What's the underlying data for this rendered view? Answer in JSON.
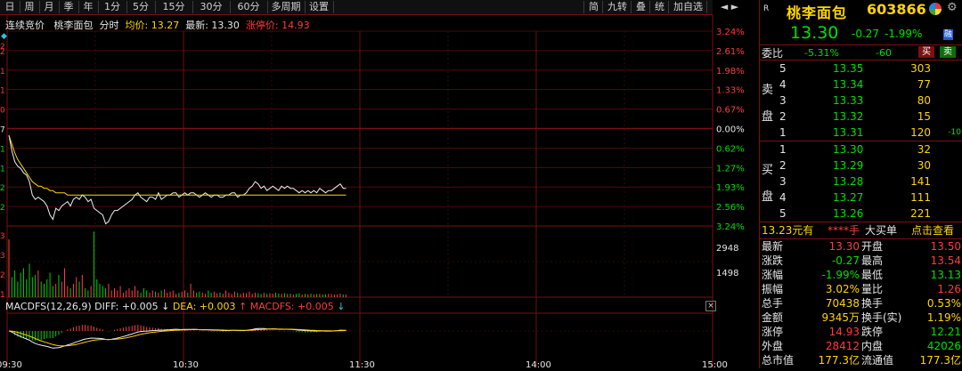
{
  "toolbar": {
    "periods": [
      "日",
      "周",
      "月",
      "季",
      "年",
      "1分",
      "5分",
      "15分",
      "30分",
      "60分",
      "多周期",
      "设置"
    ],
    "right_tools": [
      "简",
      "九转",
      "叠",
      "统",
      "加自选"
    ]
  },
  "chart_header": {
    "mode": "连续竞价",
    "stock_name": "桃李面包",
    "view": "分时",
    "avg_label": "均价: 13.27",
    "last_label": "最新: 13.30",
    "limit_up_label": "涨停价: 14.93"
  },
  "axis": {
    "right_pct": [
      "3.24%",
      "2.61%",
      "1.98%",
      "1.33%",
      "0.67%",
      "0.00%",
      "0.62%",
      "1.27%",
      "1.93%",
      "2.56%",
      "3.24%"
    ],
    "left_labels": [
      "2",
      "2",
      "1",
      "1",
      "0",
      "7",
      "1",
      "1",
      "2",
      "2"
    ],
    "vol_labels": [
      "2948",
      "1498"
    ],
    "vol_left": [
      "3",
      "3",
      "2",
      "1"
    ],
    "time_labels": [
      "09:30",
      "10:30",
      "11:30",
      "14:00",
      "15:00"
    ]
  },
  "macd": {
    "label": "MACDFS(12,26,9)",
    "diff": "DIFF: +0.005",
    "dea": "DEA: +0.003",
    "macdfs": "MACDFS: +0.005"
  },
  "panel": {
    "r_mark": "R",
    "name": "桃李面包",
    "code": "603866",
    "price": "13.30",
    "change": "-0.27",
    "change_pct": "-1.99%",
    "market_badge": "融",
    "weibi_label": "委比",
    "weibi_pct": "-5.31%",
    "weibi_val": "-60",
    "buy_btn": "买",
    "sell_btn": "卖",
    "sell_side_label": [
      "卖",
      "盘"
    ],
    "buy_side_label": [
      "买",
      "盘"
    ],
    "asks": [
      {
        "level": "5",
        "price": "13.35",
        "vol": "303",
        "delta": ""
      },
      {
        "level": "4",
        "price": "13.34",
        "vol": "77",
        "delta": ""
      },
      {
        "level": "3",
        "price": "13.33",
        "vol": "80",
        "delta": ""
      },
      {
        "level": "2",
        "price": "13.32",
        "vol": "15",
        "delta": ""
      },
      {
        "level": "1",
        "price": "13.31",
        "vol": "120",
        "delta": "-10"
      }
    ],
    "bids": [
      {
        "level": "1",
        "price": "13.30",
        "vol": "32"
      },
      {
        "level": "2",
        "price": "13.29",
        "vol": "30"
      },
      {
        "level": "3",
        "price": "13.28",
        "vol": "141"
      },
      {
        "level": "4",
        "price": "13.27",
        "vol": "111"
      },
      {
        "level": "5",
        "price": "13.26",
        "vol": "221"
      }
    ],
    "bar": {
      "price": "13.23元有",
      "stars": "****手",
      "big": "大买单",
      "link": "点击查看"
    },
    "stats": [
      {
        "l1": "最新",
        "v1": "13.30",
        "c1": "red",
        "l2": "开盘",
        "v2": "13.50",
        "c2": "red"
      },
      {
        "l1": "涨跌",
        "v1": "-0.27",
        "c1": "green",
        "l2": "最高",
        "v2": "13.54",
        "c2": "red"
      },
      {
        "l1": "涨幅",
        "v1": "-1.99%",
        "c1": "green",
        "l2": "最低",
        "v2": "13.13",
        "c2": "green"
      },
      {
        "l1": "振幅",
        "v1": "3.02%",
        "c1": "yellow",
        "l2": "量比",
        "v2": "1.26",
        "c2": "red"
      },
      {
        "l1": "总手",
        "v1": "70438",
        "c1": "yellow",
        "l2": "换手",
        "v2": "0.53%",
        "c2": "yellow"
      },
      {
        "l1": "金额",
        "v1": "9345万",
        "c1": "yellow",
        "l2": "换手(实)",
        "v2": "1.19%",
        "c2": "yellow"
      },
      {
        "l1": "涨停",
        "v1": "14.93",
        "c1": "red",
        "l2": "跌停",
        "v2": "12.21",
        "c2": "green"
      },
      {
        "l1": "外盘",
        "v1": "28412",
        "c1": "red",
        "l2": "内盘",
        "v2": "42026",
        "c2": "green"
      },
      {
        "l1": "总市值",
        "v1": "177.3亿",
        "c1": "yellow",
        "l2": "流通值",
        "v2": "177.3亿",
        "c2": "yellow"
      }
    ]
  },
  "chart_data": {
    "type": "line",
    "price_series": [
      13.54,
      13.47,
      13.42,
      13.4,
      13.39,
      13.37,
      13.36,
      13.33,
      13.27,
      13.25,
      13.26,
      13.25,
      13.24,
      13.22,
      13.18,
      13.16,
      13.21,
      13.2,
      13.22,
      13.23,
      13.24,
      13.22,
      13.25,
      13.26,
      13.25,
      13.27,
      13.26,
      13.24,
      13.25,
      13.21,
      13.2,
      13.19,
      13.18,
      13.14,
      13.15,
      13.18,
      13.2,
      13.2,
      13.21,
      13.22,
      13.23,
      13.24,
      13.25,
      13.27,
      13.28,
      13.26,
      13.25,
      13.24,
      13.26,
      13.26,
      13.25,
      13.28,
      13.25,
      13.26,
      13.27,
      13.27,
      13.28,
      13.28,
      13.26,
      13.27,
      13.28,
      13.27,
      13.28,
      13.28,
      13.27,
      13.26,
      13.27,
      13.28,
      13.27,
      13.26,
      13.27,
      13.27,
      13.26,
      13.26,
      13.27,
      13.27,
      13.28,
      13.28,
      13.26,
      13.27,
      13.27,
      13.28,
      13.3,
      13.31,
      13.33,
      13.32,
      13.3,
      13.31,
      13.29,
      13.3,
      13.31,
      13.3,
      13.29,
      13.31,
      13.3,
      13.31,
      13.3,
      13.3,
      13.29,
      13.28,
      13.29,
      13.28,
      13.29,
      13.28,
      13.29,
      13.28,
      13.3,
      13.29,
      13.28,
      13.29,
      13.29,
      13.3,
      13.31,
      13.32,
      13.3,
      13.3
    ],
    "avg_series": [
      13.54,
      13.5,
      13.46,
      13.43,
      13.41,
      13.39,
      13.37,
      13.35,
      13.33,
      13.32,
      13.31,
      13.31,
      13.3,
      13.3,
      13.29,
      13.29,
      13.28,
      13.28,
      13.28,
      13.28,
      13.27,
      13.27,
      13.27,
      13.27,
      13.27,
      13.27,
      13.27,
      13.27,
      13.27,
      13.27,
      13.27,
      13.27,
      13.27,
      13.27,
      13.27,
      13.27,
      13.27,
      13.27,
      13.27,
      13.27,
      13.27,
      13.27,
      13.27,
      13.27,
      13.27,
      13.27,
      13.27,
      13.27,
      13.27,
      13.27,
      13.27,
      13.27,
      13.27,
      13.27,
      13.27,
      13.27,
      13.27,
      13.27,
      13.27,
      13.27,
      13.27,
      13.27,
      13.27,
      13.27,
      13.27,
      13.27,
      13.27,
      13.27,
      13.27,
      13.27,
      13.27,
      13.27,
      13.27,
      13.27,
      13.27,
      13.27,
      13.27,
      13.27,
      13.27,
      13.27,
      13.27,
      13.27,
      13.27,
      13.27,
      13.27,
      13.27,
      13.27,
      13.27,
      13.27,
      13.27,
      13.27,
      13.27,
      13.27,
      13.27,
      13.27,
      13.27,
      13.27,
      13.27,
      13.27,
      13.27,
      13.27,
      13.27,
      13.27,
      13.27,
      13.27,
      13.27,
      13.27,
      13.27,
      13.27,
      13.27,
      13.27,
      13.27,
      13.27,
      13.27,
      13.27,
      13.27
    ],
    "prev_close": 13.57,
    "price_range": [
      13.13,
      14.01
    ],
    "volume_series": [
      2600,
      900,
      1200,
      700,
      1100,
      1300,
      800,
      1500,
      900,
      1000,
      1200,
      700,
      600,
      800,
      1100,
      500,
      600,
      1000,
      700,
      1300,
      500,
      400,
      600,
      900,
      700,
      1000,
      400,
      300,
      500,
      2948,
      800,
      600,
      500,
      400,
      600,
      300,
      400,
      300,
      500,
      200,
      300,
      400,
      300,
      500,
      300,
      200,
      400,
      300,
      200,
      300,
      250,
      200,
      300,
      350,
      200,
      250,
      300,
      150,
      200,
      250,
      300,
      200,
      600,
      300,
      200,
      250,
      200,
      150,
      300,
      200,
      250,
      180,
      200,
      150,
      300,
      200,
      150,
      250,
      200,
      150,
      200,
      180,
      250,
      150,
      200,
      180,
      150,
      200,
      150,
      180,
      150,
      200,
      170,
      150,
      180,
      150,
      160,
      120,
      150,
      180,
      120,
      150,
      130,
      160,
      120,
      140,
      150,
      120,
      130,
      150,
      140,
      120,
      130,
      160,
      120,
      110
    ],
    "volume_max": 3200
  }
}
